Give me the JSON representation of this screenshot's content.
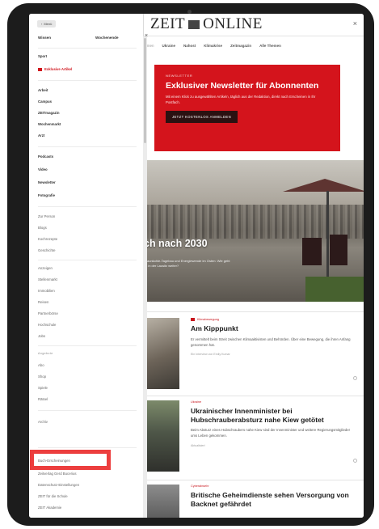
{
  "page": {
    "logo": "ZEIT ONLINE",
    "nav_links": [
      "Themen",
      "Ukraine",
      "Nahost",
      "Klimakrise",
      "Zeitmagazin",
      "Alle Themen"
    ],
    "newsletter": {
      "kicker": "NEWSLETTER",
      "headline": "Exklusiver Newsletter für Abonnenten",
      "description": "Mit einem Klick zu ausgewählten Artikeln, täglich aus der Redaktion, direkt nach Erscheinen in Ihr Postfach.",
      "cta": "JETZT KOSTENLOS ANMELDEN"
    },
    "hero": {
      "title": "ch nach 2030",
      "subtitle": "Braunkohle-Tagebau und Energiewende im Osten: Wie geht es in der Lausitz weiter?"
    },
    "articles": [
      {
        "kicker": "Klimabewegung",
        "headline": "Am Kipppunkt",
        "text": "Er vermittelt beim Streit zwischen Klimaaktivisten und Behörden. Über eine Bewegung, die ihren Anfang genommen hat.",
        "meta": "Ein Interview von Emily Kumar"
      },
      {
        "kicker": "Ukraine",
        "headline": "Ukrainischer Innenminister bei Hubschrauberabsturz nahe Kiew getötet",
        "text": "Beim Absturz eines Hubschraubers nahe Kiew sind der Innenminister und weitere Regierungsmitglieder ums Leben gekommen.",
        "meta": "Aktualisiert"
      },
      {
        "kicker": "Cyberabwehr",
        "headline": "Britische Geheimdienste sehen Versorgung von Backnet gefährdet",
        "text": "",
        "meta": ""
      }
    ]
  },
  "menu": {
    "back_label": "Menü",
    "segments": [
      "Wissen",
      "Wochenende"
    ],
    "items_group1": [
      "Sport"
    ],
    "exclusive_label": "Exklusive Artikel",
    "items_group2": [
      "Arbeit",
      "Campus",
      "ZEITmagazin",
      "Wochenmarkt",
      "Arzt"
    ],
    "items_group3": [
      "Podcasts",
      "Video",
      "Newsletter",
      "Fotografie"
    ],
    "items_group4": [
      "Zur Person",
      "Blogs",
      "Kochrezepte",
      "Geschichte"
    ],
    "items_group5": [
      "Anzeigen",
      "Stellenmarkt",
      "Immobilien",
      "Reisen",
      "Partnerbörse",
      "Hochschule",
      "Jobs"
    ],
    "section_label": "Angebote",
    "items_group6": [
      "Abo",
      "Shop",
      "Spiele",
      "Rätsel"
    ],
    "items_group7": [
      "Archiv"
    ],
    "highlighted_item": "Buch-Erscheinungen",
    "items_group8": [
      "Zeitverlag Gerd Bucerius",
      "Datenschutz-Einstellungen",
      "ZEIT für die Schule",
      "ZEIT Akademie"
    ]
  }
}
